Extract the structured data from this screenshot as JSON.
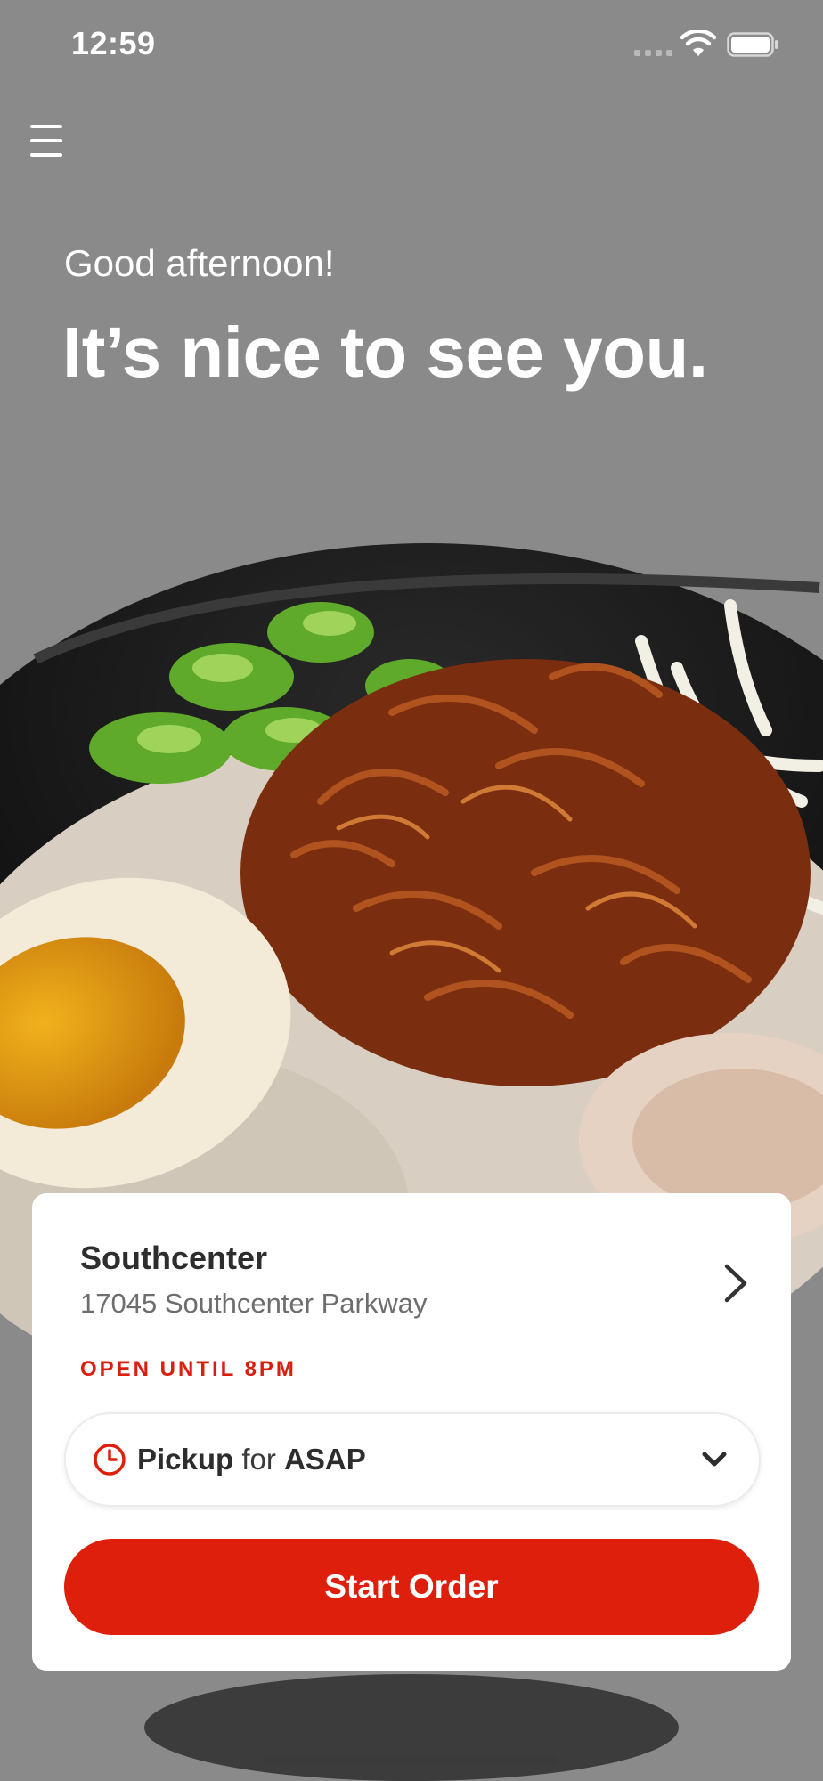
{
  "status_bar": {
    "time": "12:59"
  },
  "header": {
    "menu_icon": "hamburger-menu-icon"
  },
  "greeting": {
    "subtitle": "Good afternoon!",
    "title": "It’s nice to see you."
  },
  "location": {
    "name": "Southcenter",
    "address": "17045 Southcenter Parkway",
    "hours": "OPEN UNTIL 8PM"
  },
  "order": {
    "mode": "Pickup",
    "connector": "for",
    "time": "ASAP",
    "start_label": "Start Order"
  },
  "colors": {
    "accent": "#dd1f0b",
    "overlay": "#8a8a8a"
  }
}
